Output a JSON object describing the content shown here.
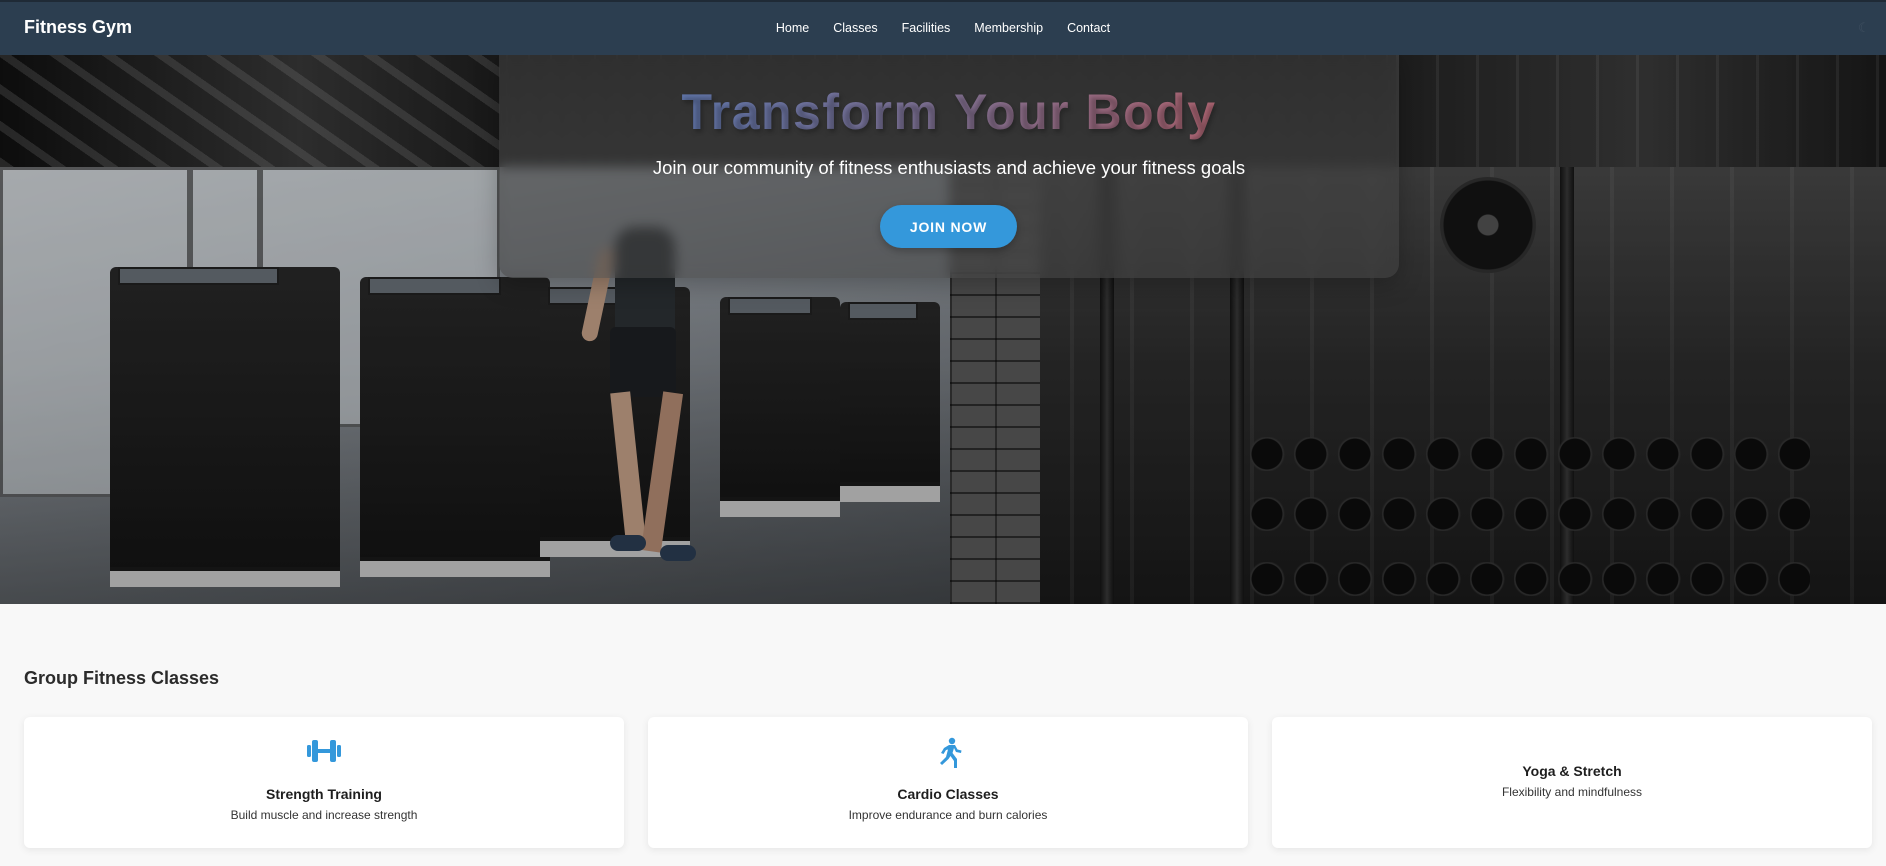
{
  "header": {
    "brand": "Fitness Gym",
    "nav": [
      "Home",
      "Classes",
      "Facilities",
      "Membership",
      "Contact"
    ],
    "theme_toggle_icon": "moon-icon"
  },
  "hero": {
    "title": "Transform Your Body",
    "subtitle": "Join our community of fitness enthusiasts and achieve your fitness goals",
    "cta_label": "JOIN NOW"
  },
  "classes": {
    "heading": "Group Fitness Classes",
    "items": [
      {
        "title": "Strength Training",
        "description": "Build muscle and increase strength",
        "icon": "dumbbell-icon"
      },
      {
        "title": "Cardio Classes",
        "description": "Improve endurance and burn calories",
        "icon": "running-icon"
      },
      {
        "title": "Yoga & Stretch",
        "description": "Flexibility and mindfulness",
        "icon": ""
      }
    ]
  },
  "colors": {
    "navbar": "#2c3e50",
    "accent": "#3498db",
    "title_gradient_start": "#4a78b8",
    "title_gradient_end": "#c95c5c",
    "page_background": "#f8f8f8"
  }
}
